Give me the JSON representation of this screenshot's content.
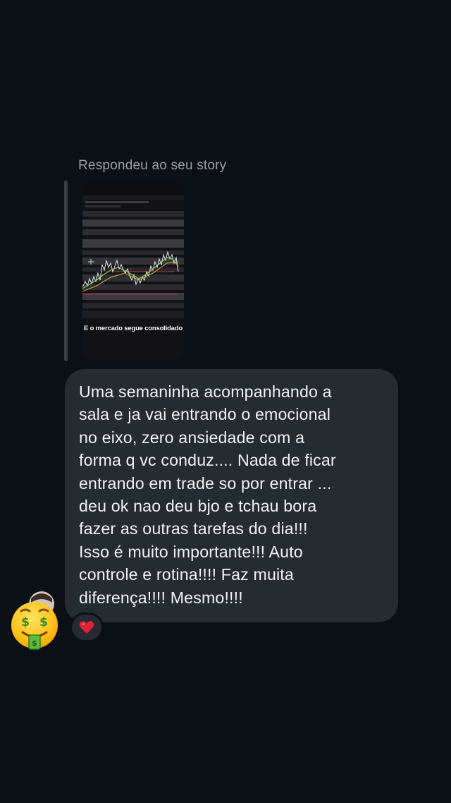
{
  "reply": {
    "label": "Respondeu ao seu story",
    "story_caption": "E o mercado segue consolidado"
  },
  "message": {
    "lines": [
      "Uma semaninha acompanhando a",
      "sala e ja vai entrando o emocional",
      "no eixo, zero ansiedade com a",
      "forma q vc conduz.... Nada de ficar",
      "entrando em trade so por entrar ...",
      "deu ok nao deu bjo e tchau bora",
      "fazer as outras tarefas do dia!!!",
      "Isso é muito importante!!! Auto",
      "controle e rotina!!!! Faz muita",
      "diferença!!!! Mesmo!!!!"
    ]
  },
  "reaction": {
    "icon": "heart-icon",
    "color": "#e0213a"
  },
  "avatar": {
    "icon": "money-mouth-face-icon"
  },
  "colors": {
    "background": "#0b0f16",
    "bubble": "#262a31",
    "text": "#f1f2f4",
    "secondary_text": "#9a9ea6"
  }
}
